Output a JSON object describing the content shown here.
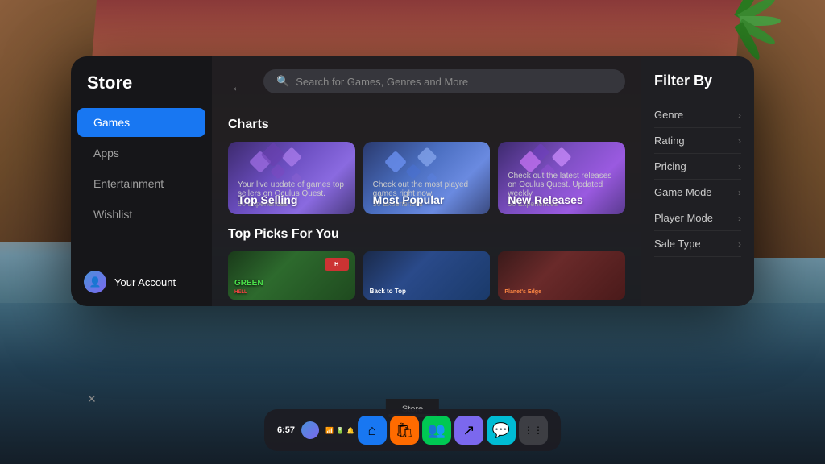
{
  "app": {
    "title": "Store"
  },
  "background": {
    "description": "VR environment with desert landscape, rocks, palm trees, water"
  },
  "sidebar": {
    "title": "Store",
    "nav_items": [
      {
        "id": "games",
        "label": "Games",
        "active": true
      },
      {
        "id": "apps",
        "label": "Apps",
        "active": false
      },
      {
        "id": "entertainment",
        "label": "Entertainment",
        "active": false
      },
      {
        "id": "wishlist",
        "label": "Wishlist",
        "active": false
      }
    ],
    "account": {
      "label": "Your Account"
    }
  },
  "search": {
    "placeholder": "Search for Games, Genres and More"
  },
  "sections": {
    "charts": {
      "title": "Charts",
      "cards": [
        {
          "id": "top-selling",
          "label": "Top Selling",
          "description": "Your live update of games top sellers on Oculus Quest.",
          "meta": "50 Experiences"
        },
        {
          "id": "most-popular",
          "label": "Most Popular",
          "description": "Check out the most played games right now.",
          "meta": "30 Experiences"
        },
        {
          "id": "new-releases",
          "label": "New Releases",
          "description": "Check out the latest releases on Oculus Quest. Updated weekly.",
          "meta": "50 Experiences"
        }
      ]
    },
    "top_picks": {
      "title": "Top Picks For You",
      "items": [
        {
          "id": "green-hell",
          "label": "Green Hell"
        },
        {
          "id": "back-to-top",
          "label": "Back to Top"
        },
        {
          "id": "planets-edge",
          "label": "Planet's Edge"
        }
      ]
    }
  },
  "filter": {
    "title": "Filter By",
    "items": [
      {
        "id": "genre",
        "label": "Genre"
      },
      {
        "id": "rating",
        "label": "Rating"
      },
      {
        "id": "pricing",
        "label": "Pricing"
      },
      {
        "id": "game-mode",
        "label": "Game Mode"
      },
      {
        "id": "player-mode",
        "label": "Player Mode"
      },
      {
        "id": "sale-type",
        "label": "Sale Type"
      }
    ]
  },
  "store_bar": {
    "label": "Store"
  },
  "taskbar": {
    "time": "6:57",
    "icons": [
      {
        "id": "home",
        "symbol": "⌂",
        "color": "ti-blue"
      },
      {
        "id": "store",
        "symbol": "🛍",
        "color": "ti-orange"
      },
      {
        "id": "social",
        "symbol": "👥",
        "color": "ti-green"
      },
      {
        "id": "arrow",
        "symbol": "↗",
        "color": "ti-purple"
      },
      {
        "id": "chat",
        "symbol": "💬",
        "color": "ti-teal"
      },
      {
        "id": "grid",
        "symbol": "⋮⋮",
        "color": "ti-dots"
      }
    ]
  },
  "window_controls": {
    "close": "✕",
    "minimize": "—"
  }
}
